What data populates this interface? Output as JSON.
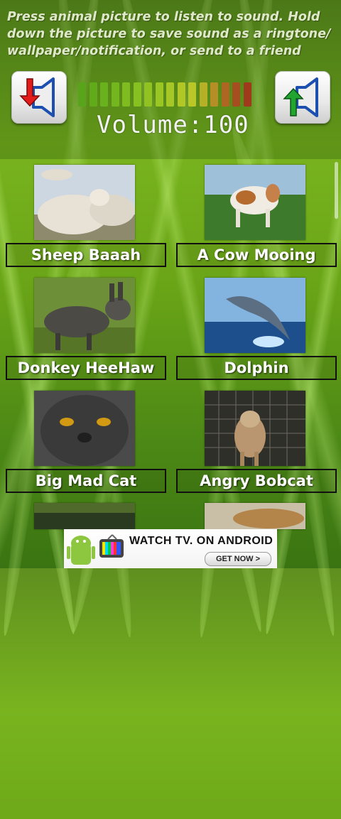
{
  "instructions": "Press animal picture to listen to sound. Hold down the picture to save sound as a ringtone/ wallpaper/notification, or send to a friend",
  "volume": {
    "label": "Volume:100",
    "level_percent": 100,
    "bar_colors": [
      "#58a51b",
      "#61ab1b",
      "#69b11d",
      "#73b61e",
      "#7ebc20",
      "#87c021",
      "#90c322",
      "#9ac624",
      "#a6c725",
      "#b0c726",
      "#b9c727",
      "#b6b026",
      "#b58e25",
      "#ae6722",
      "#a64e1f",
      "#9f3a1c"
    ]
  },
  "buttons": {
    "volume_down_icon": "volume-down-icon",
    "volume_up_icon": "volume-up-icon"
  },
  "animals": [
    {
      "label": "Sheep Baaah"
    },
    {
      "label": "A Cow Mooing"
    },
    {
      "label": "Donkey HeeHaw"
    },
    {
      "label": "Dolphin"
    },
    {
      "label": "Big Mad Cat"
    },
    {
      "label": "Angry Bobcat"
    }
  ],
  "ad": {
    "headline": "WATCH TV. ON ANDROID",
    "cta": "GET NOW >"
  }
}
